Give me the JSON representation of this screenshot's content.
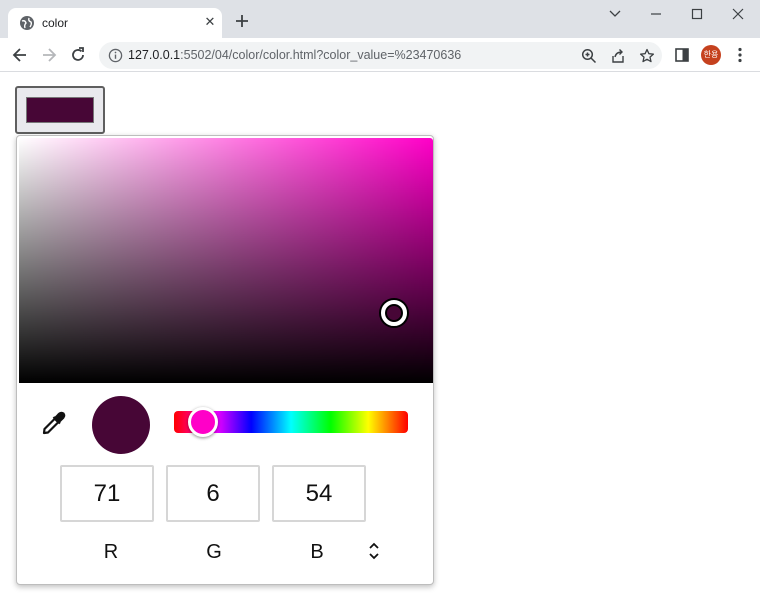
{
  "browser": {
    "tab_title": "color",
    "tab_close_glyph": "✕",
    "url_host": "127.0.0.1",
    "url_rest": ":5502/04/color/color.html?color_value=%23470636",
    "profile_initials": "한용",
    "accent_color": "#c5411e"
  },
  "page": {
    "selected_color": "#470636"
  },
  "picker": {
    "hue_color": "#ff00c8",
    "rgb": [
      {
        "channel": "R",
        "value": "71"
      },
      {
        "channel": "G",
        "value": "6"
      },
      {
        "channel": "B",
        "value": "54"
      }
    ],
    "icons": [
      "eyedropper-icon",
      "mode-toggle-icon"
    ]
  }
}
